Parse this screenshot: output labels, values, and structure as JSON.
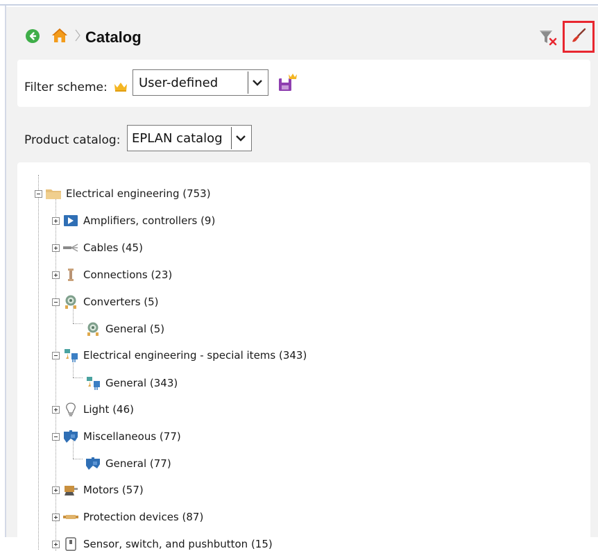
{
  "header": {
    "title": "Catalog",
    "icons": [
      "back-arrow-icon",
      "home-icon",
      "filter-clear-icon",
      "brush-icon"
    ],
    "highlight_color": "#e8262f"
  },
  "filter_scheme": {
    "label": "Filter scheme:",
    "value": "User-defined"
  },
  "product_catalog": {
    "label": "Product catalog:",
    "value": "EPLAN catalog"
  },
  "tree": [
    {
      "label": "Electrical engineering (753)",
      "icon": "folder-icon",
      "expanded": true
    },
    {
      "label": "Amplifiers, controllers (9)",
      "icon": "amplifier-icon",
      "expanded": false
    },
    {
      "label": "Cables (45)",
      "icon": "cable-icon",
      "expanded": false
    },
    {
      "label": "Connections (23)",
      "icon": "connection-icon",
      "expanded": false
    },
    {
      "label": "Converters (5)",
      "icon": "converter-icon",
      "expanded": true
    },
    {
      "label": "General (5)",
      "icon": "converter-icon"
    },
    {
      "label": "Electrical engineering - special items (343)",
      "icon": "special-items-icon",
      "expanded": true
    },
    {
      "label": "General (343)",
      "icon": "special-items-icon"
    },
    {
      "label": "Light (46)",
      "icon": "lightbulb-icon",
      "expanded": false
    },
    {
      "label": "Miscellaneous (77)",
      "icon": "puzzle-icon",
      "expanded": true
    },
    {
      "label": "General (77)",
      "icon": "puzzle-icon"
    },
    {
      "label": "Motors (57)",
      "icon": "motor-icon",
      "expanded": false
    },
    {
      "label": "Protection devices (87)",
      "icon": "fuse-icon",
      "expanded": false
    },
    {
      "label": "Sensor, switch, and pushbutton (15)",
      "icon": "sensor-icon",
      "expanded": false
    }
  ]
}
